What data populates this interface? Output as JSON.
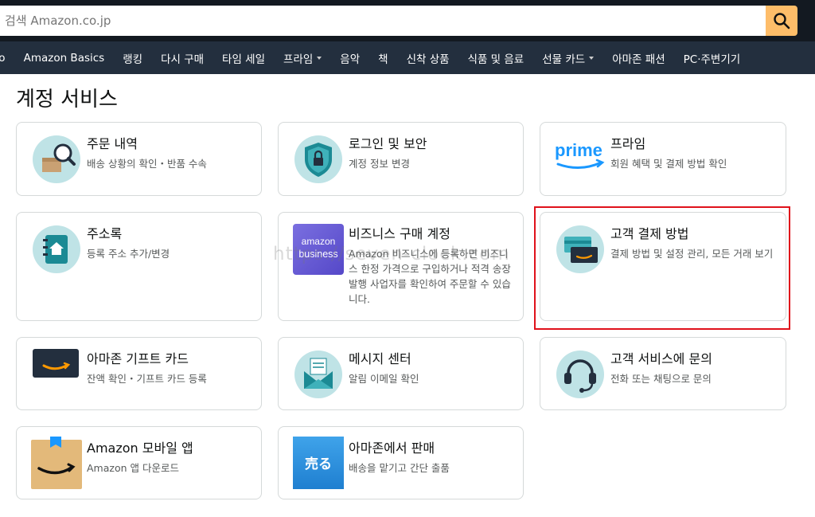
{
  "search": {
    "placeholder": "검색 Amazon.co.jp"
  },
  "nav": {
    "items": [
      {
        "label": "eo",
        "caret": false
      },
      {
        "label": "Amazon Basics",
        "caret": false
      },
      {
        "label": "랭킹",
        "caret": false
      },
      {
        "label": "다시 구매",
        "caret": false
      },
      {
        "label": "타임 세일",
        "caret": false
      },
      {
        "label": "프라임",
        "caret": true
      },
      {
        "label": "음악",
        "caret": false
      },
      {
        "label": "책",
        "caret": false
      },
      {
        "label": "신착 상품",
        "caret": false
      },
      {
        "label": "식품 및 음료",
        "caret": false
      },
      {
        "label": "선물 카드",
        "caret": true
      },
      {
        "label": "아마존 패션",
        "caret": false
      },
      {
        "label": "PC·주변기기",
        "caret": false
      }
    ]
  },
  "page": {
    "title": "계정 서비스"
  },
  "cards": [
    {
      "title": "주문 내역",
      "desc": "배송 상황의 확인・반품 수속",
      "icon": "order-search-icon"
    },
    {
      "title": "로그인 및 보안",
      "desc": "계정 정보 변경",
      "icon": "security-shield-icon"
    },
    {
      "title": "프라임",
      "desc": "회원 혜택 및 결제 방법 확인",
      "icon": "prime-logo-icon",
      "logo_text": "prime"
    },
    {
      "title": "주소록",
      "desc": "등록 주소 추가/변경",
      "icon": "address-book-icon"
    },
    {
      "title": "비즈니스 구매 계정",
      "desc": "Amazon 비즈니스에 등록하면 비즈니스 한정 가격으로 구입하거나 적격 송장 발행 사업자를 확인하여 주문할 수 있습니다.",
      "icon": "amazon-business-icon",
      "logo_line1": "amazon",
      "logo_line2": "business"
    },
    {
      "title": "고객 결제 방법",
      "desc": "결제 방법 및 설정 관리, 모든 거래 보기",
      "icon": "payment-cards-icon"
    },
    {
      "title": "아마존 기프트 카드",
      "desc": "잔액 확인・기프트 카드 등록",
      "icon": "gift-card-icon"
    },
    {
      "title": "메시지 센터",
      "desc": "알림 이메일 확인",
      "icon": "mail-envelope-icon"
    },
    {
      "title": "고객 서비스에 문의",
      "desc": "전화 또는 채팅으로 문의",
      "icon": "headset-icon"
    },
    {
      "title": "Amazon 모바일 앱",
      "desc": "Amazon 앱 다운로드",
      "icon": "amazon-app-icon"
    },
    {
      "title": "아마존에서 판매",
      "desc": "배송을 맡기고 간단 출품",
      "icon": "sell-icon",
      "logo_text": "売る"
    }
  ],
  "watermark": "https://seven-clock.com",
  "colors": {
    "header": "#131921",
    "nav": "#232f3e",
    "search_button": "#febd69",
    "highlight": "#e0121b",
    "prime_blue": "#1a98ff",
    "teal_circle": "#bfe3e6"
  }
}
